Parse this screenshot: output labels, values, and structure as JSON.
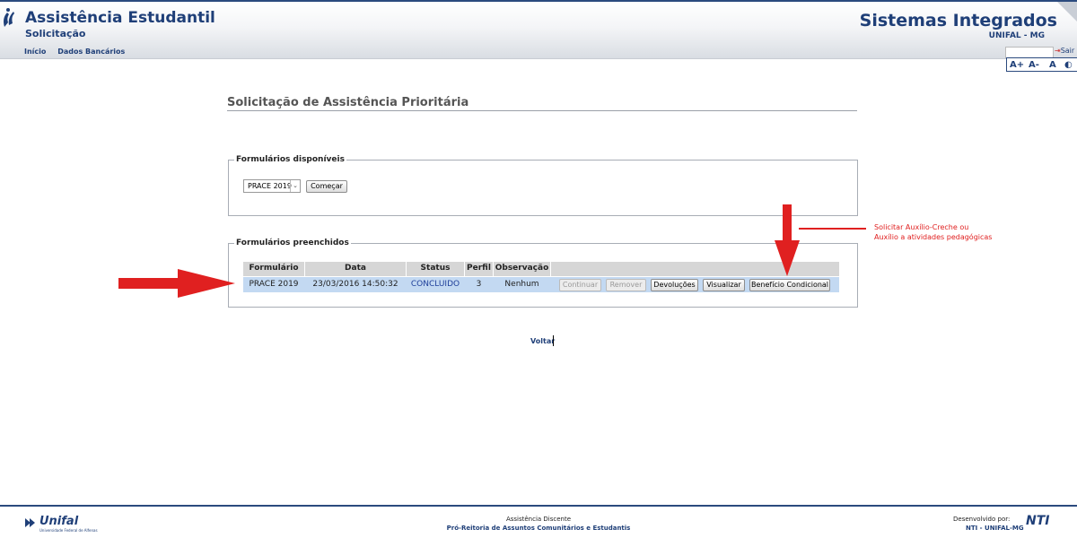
{
  "header": {
    "app_title": "Assistência Estudantil",
    "app_subtitle": "Solicitação",
    "nav": [
      "Início",
      "Dados Bancários"
    ],
    "system_title": "Sistemas Integrados",
    "system_subtitle": "UNIFAL - MG",
    "logout_label": "Sair",
    "accessibility": {
      "increase": "A+",
      "decrease": "A-",
      "reset": "A",
      "contrast_icon": "contrast-icon"
    }
  },
  "main": {
    "page_title": "Solicitação de Assistência Prioritária",
    "available_forms": {
      "legend": "Formulários disponíveis",
      "select_value": "PRACE 2019",
      "start_button": "Começar"
    },
    "filled_forms": {
      "legend": "Formulários preenchidos",
      "columns": [
        "Formulário",
        "Data",
        "Status",
        "Perfil",
        "Observação"
      ],
      "rows": [
        {
          "form": "PRACE 2019",
          "date": "23/03/2016 14:50:32",
          "status": "CONCLUIDO",
          "profile": "3",
          "note": "Nenhum",
          "actions": [
            "Continuar",
            "Remover",
            "Devoluções",
            "Visualizar",
            "Benefício Condicional"
          ]
        }
      ]
    },
    "back_link": "Voltar"
  },
  "annotation": {
    "line1": "Solicitar Auxílio-Creche ou",
    "line2": "Auxílio a atividades pedagógicas",
    "color": "#e02020"
  },
  "footer": {
    "center_line1": "Assistência Discente",
    "center_line2": "Pró-Reitoria de Assuntos Comunitários e Estudantis",
    "right_line1": "Desenvolvido por:",
    "right_line2": "NTI - UNIFAL-MG",
    "left_logo_text": "Unifal",
    "left_logo_sub": "Universidade Federal de Alfenas",
    "right_logo_text": "NTI"
  },
  "colors": {
    "brand": "#1f3f78",
    "row_highlight": "#c3d9f2",
    "header_row": "#d6d6d6",
    "arrow": "#e02020"
  }
}
